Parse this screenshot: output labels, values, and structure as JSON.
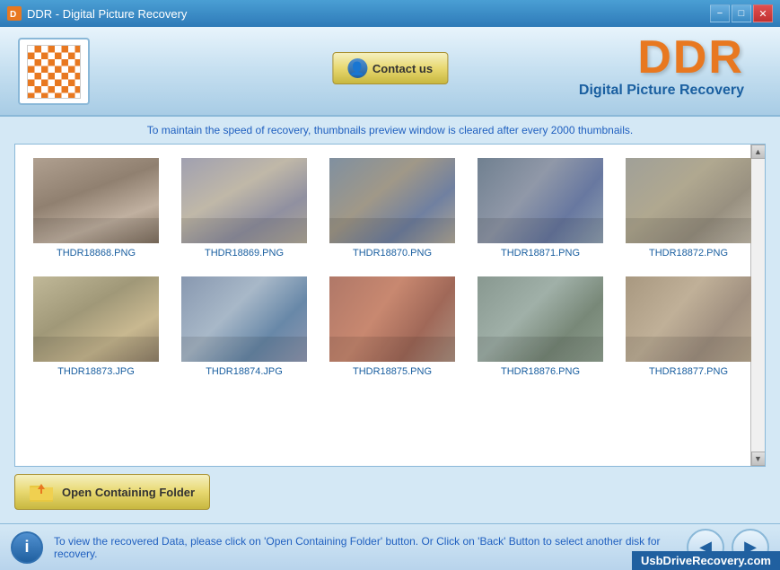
{
  "titlebar": {
    "title": "DDR - Digital Picture Recovery",
    "min": "−",
    "restore": "□",
    "close": "✕"
  },
  "header": {
    "contact_button": "Contact us",
    "brand": "DDR",
    "subtitle": "Digital Picture Recovery"
  },
  "info_text": {
    "prefix": "To maintain the speed of recovery,",
    "highlight": " thumbnails preview window is cleared after every 2000 thumbnails.",
    "suffix": ""
  },
  "thumbnails": {
    "row1": [
      {
        "name": "THDR18868.PNG",
        "class": "p1"
      },
      {
        "name": "THDR18869.PNG",
        "class": "p2"
      },
      {
        "name": "THDR18870.PNG",
        "class": "p3"
      },
      {
        "name": "THDR18871.PNG",
        "class": "p4"
      },
      {
        "name": "THDR18872.PNG",
        "class": "p5"
      }
    ],
    "row2": [
      {
        "name": "THDR18873.JPG",
        "class": "p6"
      },
      {
        "name": "THDR18874.JPG",
        "class": "p7"
      },
      {
        "name": "THDR18875.PNG",
        "class": "p8"
      },
      {
        "name": "THDR18876.PNG",
        "class": "p9"
      },
      {
        "name": "THDR18877.PNG",
        "class": "p10"
      }
    ]
  },
  "open_folder_btn": "Open Containing Folder",
  "footer": {
    "text_prefix": "To view the recovered Data, please click on 'Open Containing Folder' button. Or Click on 'Back' Button to select another disk for",
    "text_link": "recovery.",
    "brand": "UsbDriveRecovery.com"
  }
}
